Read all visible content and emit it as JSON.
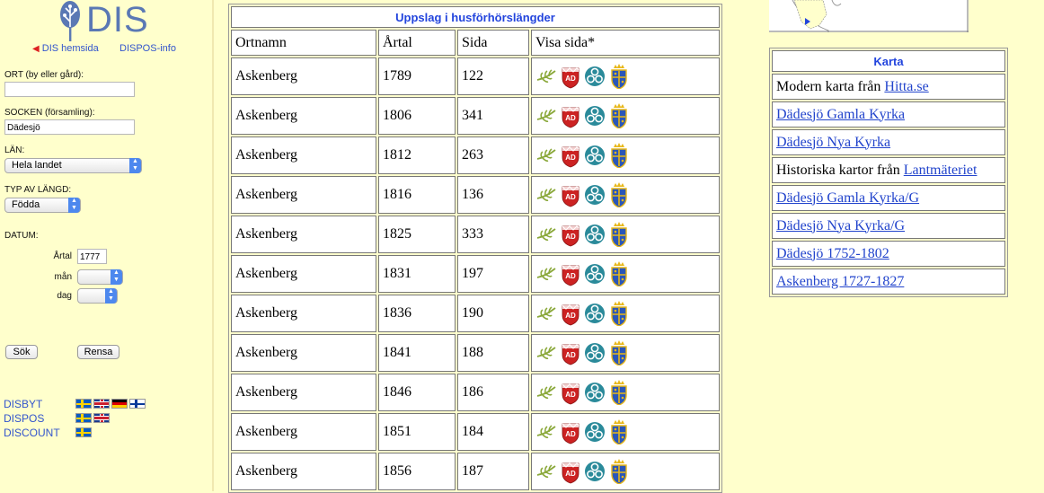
{
  "brand": {
    "logo_text": "DIS",
    "link_home": "DIS hemsida",
    "link_info": "DISPOS-info"
  },
  "search": {
    "ort_label": "ORT (by eller gård):",
    "ort_value": "",
    "socken_label": "SOCKEN (församling):",
    "socken_value": "Dädesjö",
    "lan_label": "LÄN:",
    "lan_value": "Hela landet",
    "typ_label": "TYP AV LÄNGD:",
    "typ_value": "Födda",
    "datum_label": "DATUM:",
    "artal_label": "Årtal",
    "artal_value": "1777",
    "man_label": "mån",
    "man_value": "",
    "dag_label": "dag",
    "dag_value": "",
    "search_button": "Sök",
    "clear_button": "Rensa"
  },
  "products": [
    {
      "name": "DISBYT",
      "flags": [
        "se",
        "uk",
        "de",
        "fi"
      ]
    },
    {
      "name": "DISPOS",
      "flags": [
        "se",
        "uk"
      ]
    },
    {
      "name": "DISCOUNT",
      "flags": [
        "se"
      ]
    }
  ],
  "results": {
    "caption": "Uppslag i husförhörslängder",
    "headers": [
      "Ortnamn",
      "Årtal",
      "Sida",
      "Visa sida*"
    ],
    "icons": [
      "fern-icon",
      "ad-shield-icon",
      "circle-knot-icon",
      "crown-shield-icon"
    ],
    "rows": [
      {
        "ortnamn": "Askenberg",
        "artal": "1789",
        "sida": "122"
      },
      {
        "ortnamn": "Askenberg",
        "artal": "1806",
        "sida": "341"
      },
      {
        "ortnamn": "Askenberg",
        "artal": "1812",
        "sida": "263"
      },
      {
        "ortnamn": "Askenberg",
        "artal": "1816",
        "sida": "136"
      },
      {
        "ortnamn": "Askenberg",
        "artal": "1825",
        "sida": "333"
      },
      {
        "ortnamn": "Askenberg",
        "artal": "1831",
        "sida": "197"
      },
      {
        "ortnamn": "Askenberg",
        "artal": "1836",
        "sida": "190"
      },
      {
        "ortnamn": "Askenberg",
        "artal": "1841",
        "sida": "188"
      },
      {
        "ortnamn": "Askenberg",
        "artal": "1846",
        "sida": "186"
      },
      {
        "ortnamn": "Askenberg",
        "artal": "1851",
        "sida": "184"
      },
      {
        "ortnamn": "Askenberg",
        "artal": "1856",
        "sida": "187"
      }
    ]
  },
  "karta": {
    "caption": "Karta",
    "rows": [
      {
        "text": "Modern karta från ",
        "link": "Hitta.se"
      },
      {
        "text": "",
        "link": "Dädesjö Gamla Kyrka"
      },
      {
        "text": "",
        "link": "Dädesjö Nya Kyrka"
      },
      {
        "text": "Historiska kartor från ",
        "link": "Lantmäteriet"
      },
      {
        "text": "",
        "link": "Dädesjö Gamla Kyrka/G"
      },
      {
        "text": "",
        "link": "Dädesjö Nya Kyrka/G"
      },
      {
        "text": "",
        "link": "Dädesjö 1752-1802"
      },
      {
        "text": "",
        "link": "Askenberg 1727-1827"
      }
    ]
  },
  "colors": {
    "background": "#ffffcc",
    "link": "#2244cc",
    "caption": "#2244dd"
  }
}
